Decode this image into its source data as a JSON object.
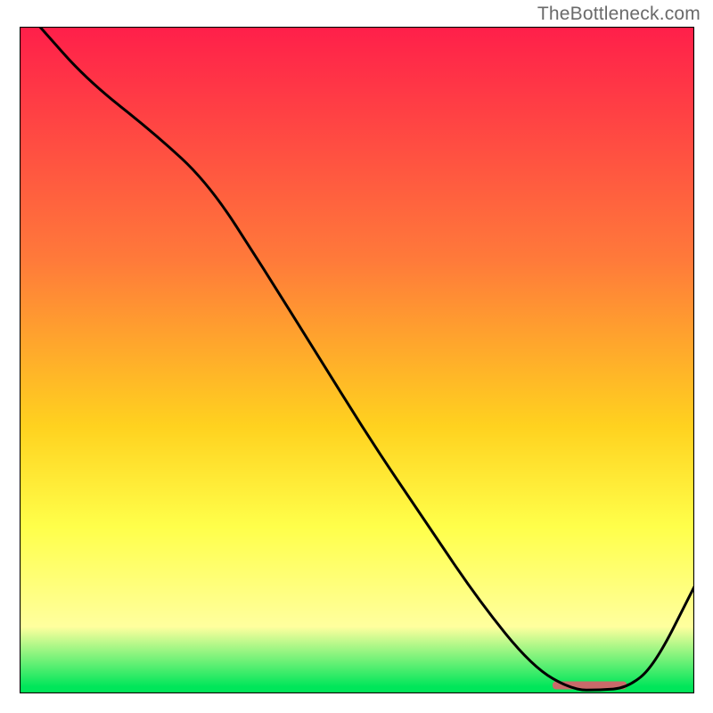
{
  "attribution": "TheBottleneck.com",
  "colors": {
    "curve_stroke": "#000000",
    "frame_stroke": "#000000",
    "marker_fill": "#c96a6a",
    "grad_top": "#ff1f4a",
    "grad_mid1": "#ff7a3a",
    "grad_mid2": "#ffd21f",
    "grad_mid3": "#ffff4a",
    "grad_pale": "#ffff9e",
    "grad_bottom": "#00e65a"
  },
  "chart_data": {
    "type": "line",
    "title": "",
    "xlabel": "",
    "ylabel": "",
    "xlim": [
      0,
      100
    ],
    "ylim": [
      0,
      100
    ],
    "x": [
      3,
      10,
      20,
      28,
      36,
      44,
      52,
      60,
      68,
      76,
      82,
      86,
      90,
      94,
      100
    ],
    "values": [
      100,
      92,
      84,
      76.5,
      64,
      51,
      38,
      26,
      14,
      4,
      0.5,
      0.5,
      0.8,
      4,
      16
    ],
    "marker": {
      "x_start": 79,
      "x_end": 90,
      "y": 1.2
    }
  }
}
